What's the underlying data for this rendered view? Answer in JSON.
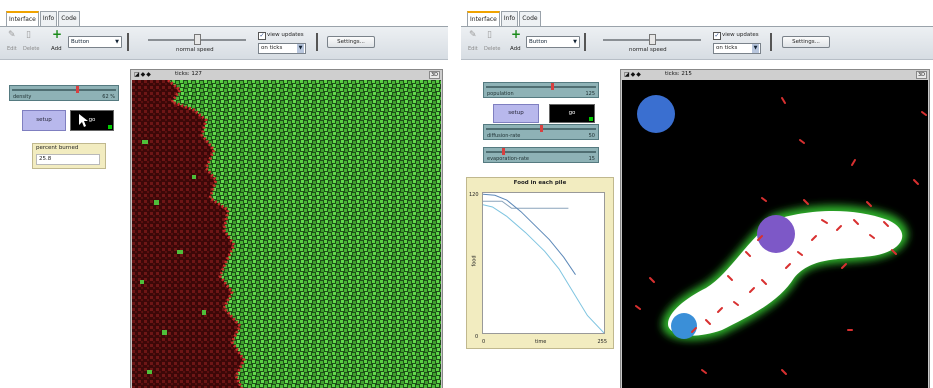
{
  "left": {
    "tabs": [
      "Interface",
      "Info",
      "Code"
    ],
    "toolbar": {
      "edit_label": "Edit",
      "delete_label": "Delete",
      "add_label": "Add",
      "widget_select": "Button",
      "speed_label": "normal speed",
      "view_updates_label": "view updates",
      "update_mode": "on ticks",
      "settings_label": "Settings...",
      "speed": 0.5
    },
    "widgets": {
      "density": {
        "name": "density",
        "value": "62 %",
        "fraction": 0.62
      },
      "setup_label": "setup",
      "go_label": "go",
      "monitor_label": "percent burned",
      "monitor_value": "25.8"
    },
    "view": {
      "ticks_label": "ticks: 127",
      "three_d": "3D"
    }
  },
  "right": {
    "tabs": [
      "Interface",
      "Info",
      "Code"
    ],
    "toolbar": {
      "edit_label": "Edit",
      "delete_label": "Delete",
      "add_label": "Add",
      "widget_select": "Button",
      "speed_label": "normal speed",
      "view_updates_label": "view updates",
      "update_mode": "on ticks",
      "settings_label": "Settings...",
      "speed": 0.5
    },
    "widgets": {
      "population": {
        "name": "population",
        "value": "125",
        "fraction": 0.6
      },
      "diffusion": {
        "name": "diffusion-rate",
        "value": "50",
        "fraction": 0.5
      },
      "evaporation": {
        "name": "evaporation-rate",
        "value": "15",
        "fraction": 0.15
      },
      "setup_label": "setup",
      "go_label": "go"
    },
    "view": {
      "ticks_label": "ticks: 215",
      "three_d": "3D"
    },
    "plot": {
      "title": "Food in each pile",
      "ylabel": "food",
      "xlabel": "time",
      "ymax_label": "120",
      "ymin_label": "0",
      "xmin_label": "0",
      "xmax_label": "255"
    }
  },
  "chart_data": {
    "type": "line",
    "title": "Food in each pile",
    "xlabel": "time",
    "ylabel": "food",
    "xlim": [
      0,
      255
    ],
    "ylim": [
      0,
      120
    ],
    "series": [
      {
        "color": "#8aa4bc",
        "x": [
          0,
          40,
          60,
          180
        ],
        "y": [
          113,
          113,
          107,
          107
        ]
      },
      {
        "color": "#5c88b8",
        "x": [
          0,
          25,
          50,
          80,
          110,
          140,
          170,
          195
        ],
        "y": [
          119,
          118,
          114,
          104,
          92,
          80,
          65,
          50
        ]
      },
      {
        "color": "#7ec4e0",
        "x": [
          0,
          20,
          50,
          90,
          130,
          160,
          190,
          220,
          255
        ],
        "y": [
          110,
          108,
          100,
          86,
          70,
          55,
          35,
          15,
          0
        ]
      }
    ]
  },
  "colors": {
    "background": "#000000",
    "trees": "#4fbf3a",
    "burned": "#6a1414",
    "fire": "#d83030",
    "ant": "#d83030",
    "chemical": "#ffffff",
    "food_pile_1": "#3a6fd0",
    "food_pile_2": "#7d58c7",
    "food_pile_3": "#3a8fd8",
    "nest": "#8a3fc0"
  },
  "icons": [
    "edit-icon",
    "delete-icon",
    "add-icon",
    "chevron-down-icon",
    "checkbox-icon",
    "forever-icon",
    "mouse-pointer-icon"
  ]
}
